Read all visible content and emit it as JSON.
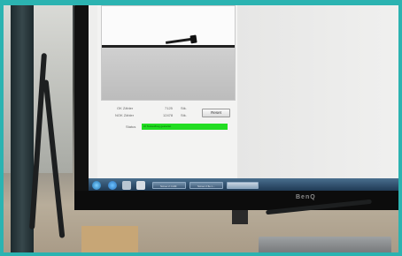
{
  "screen_app": {
    "counters": [
      {
        "label": "OK Zähler",
        "value": "7125",
        "unit": "Stk."
      },
      {
        "label": "NOK Zähler",
        "value": "12478",
        "unit": "Stk."
      }
    ],
    "reset_label": "Reset",
    "status_label": "Status",
    "status_text": "iO Testauftrag gestartet",
    "status_color": "#22dd22"
  },
  "taskbar": {
    "windows": [
      "Screw 2 CAM",
      "Screw 2 fle n...",
      ""
    ]
  },
  "monitor_brand": "BenQ"
}
